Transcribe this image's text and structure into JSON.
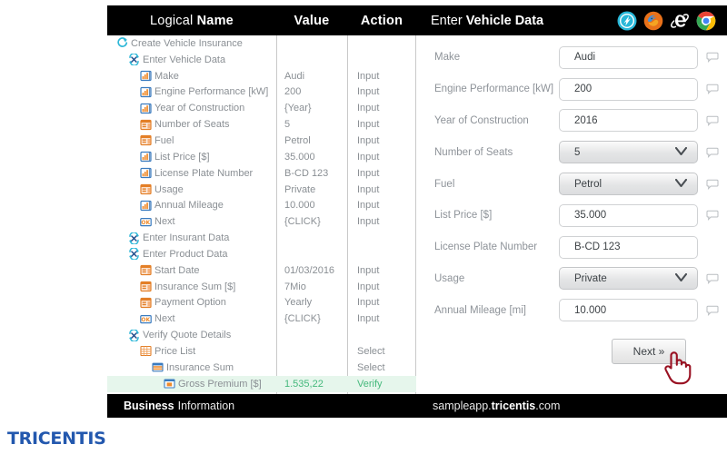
{
  "left_panel": {
    "columns": {
      "name_light": "Logical ",
      "name_bold": "Name",
      "value": "Value",
      "action": "Action"
    },
    "rows": [
      {
        "label": "Create Vehicle Insurance",
        "indent": 0,
        "icon": "refresh-icon",
        "value": "",
        "action": ""
      },
      {
        "label": "Enter Vehicle Data",
        "indent": 1,
        "icon": "process-icon",
        "value": "",
        "action": ""
      },
      {
        "label": "Make",
        "indent": 2,
        "icon": "input-icon",
        "value": "Audi",
        "action": "Input"
      },
      {
        "label": "Engine Performance [kW]",
        "indent": 2,
        "icon": "input-icon",
        "value": "200",
        "action": "Input"
      },
      {
        "label": "Year of Construction",
        "indent": 2,
        "icon": "input-icon",
        "value": "{Year}",
        "action": "Input"
      },
      {
        "label": "Number of Seats",
        "indent": 2,
        "icon": "dropdown-icon",
        "value": "5",
        "action": "Input"
      },
      {
        "label": "Fuel",
        "indent": 2,
        "icon": "dropdown-icon",
        "value": "Petrol",
        "action": "Input"
      },
      {
        "label": "List Price [$]",
        "indent": 2,
        "icon": "input-icon",
        "value": "35.000",
        "action": "Input"
      },
      {
        "label": "License Plate Number",
        "indent": 2,
        "icon": "input-icon",
        "value": "B-CD 123",
        "action": "Input"
      },
      {
        "label": "Usage",
        "indent": 2,
        "icon": "dropdown-icon",
        "value": "Private",
        "action": "Input"
      },
      {
        "label": "Annual Mileage",
        "indent": 2,
        "icon": "input-icon",
        "value": "10.000",
        "action": "Input"
      },
      {
        "label": "Next",
        "indent": 2,
        "icon": "ok-icon",
        "value": "{CLICK}",
        "action": "Input"
      },
      {
        "label": "Enter Insurant Data",
        "indent": 1,
        "icon": "process-icon",
        "value": "",
        "action": ""
      },
      {
        "label": "Enter Product Data",
        "indent": 1,
        "icon": "process-icon",
        "value": "",
        "action": ""
      },
      {
        "label": "Start Date",
        "indent": 2,
        "icon": "dropdown-icon",
        "value": "01/03/2016",
        "action": "Input"
      },
      {
        "label": "Insurance Sum [$]",
        "indent": 2,
        "icon": "dropdown-icon",
        "value": "7Mio",
        "action": "Input"
      },
      {
        "label": "Payment Option",
        "indent": 2,
        "icon": "dropdown-icon",
        "value": "Yearly",
        "action": "Input"
      },
      {
        "label": "Next",
        "indent": 2,
        "icon": "ok-icon",
        "value": "{CLICK}",
        "action": "Input"
      },
      {
        "label": "Verify Quote Details",
        "indent": 1,
        "icon": "process-icon",
        "value": "",
        "action": ""
      },
      {
        "label": "Price List",
        "indent": 2,
        "icon": "table-icon",
        "value": "",
        "action": "Select"
      },
      {
        "label": "Insurance Sum",
        "indent": 3,
        "icon": "table-row-icon",
        "value": "",
        "action": "Select"
      },
      {
        "label": "Gross Premium [$]",
        "indent": 4,
        "icon": "cell-icon",
        "value": "1.535,22",
        "action": "Verify",
        "highlight": true
      }
    ],
    "footer": {
      "bold": "Business",
      "light": "Information"
    }
  },
  "right_panel": {
    "title_light": "Enter ",
    "title_bold": "Vehicle Data",
    "browser_icons": [
      "tricentis-tosca-icon",
      "firefox-icon",
      "internet-explorer-icon",
      "chrome-icon"
    ],
    "fields": [
      {
        "label": "Make",
        "value": "Audi",
        "type": "text",
        "bubble": true
      },
      {
        "label": "Engine Performance [kW]",
        "value": "200",
        "type": "text",
        "bubble": true
      },
      {
        "label": "Year of Construction",
        "value": "2016",
        "type": "text",
        "bubble": true
      },
      {
        "label": "Number of Seats",
        "value": "5",
        "type": "dropdown",
        "bubble": true
      },
      {
        "label": "Fuel",
        "value": "Petrol",
        "type": "dropdown",
        "bubble": true
      },
      {
        "label": "List Price [$]",
        "value": "35.000",
        "type": "text",
        "bubble": true
      },
      {
        "label": "License Plate Number",
        "value": "B-CD 123",
        "type": "text",
        "bubble": false
      },
      {
        "label": "Usage",
        "value": "Private",
        "type": "dropdown",
        "bubble": true
      },
      {
        "label": "Annual Mileage [mi]",
        "value": "10.000",
        "type": "text",
        "bubble": true
      }
    ],
    "next_button": "Next »",
    "cursor": "pointing-hand-cursor",
    "footer": {
      "light1": "sampleapp.",
      "bold": "tricentis",
      "light2": ".com"
    }
  },
  "logo": {
    "text": "TRICENTIS",
    "color": "#2358ae"
  },
  "colors": {
    "header_bg": "#000000",
    "highlight_bg": "#e6f6ec",
    "highlight_text": "#45b97c",
    "tree_text": "#8a8f94",
    "label_text": "#8e9399",
    "brand_blue": "#2358ae"
  }
}
